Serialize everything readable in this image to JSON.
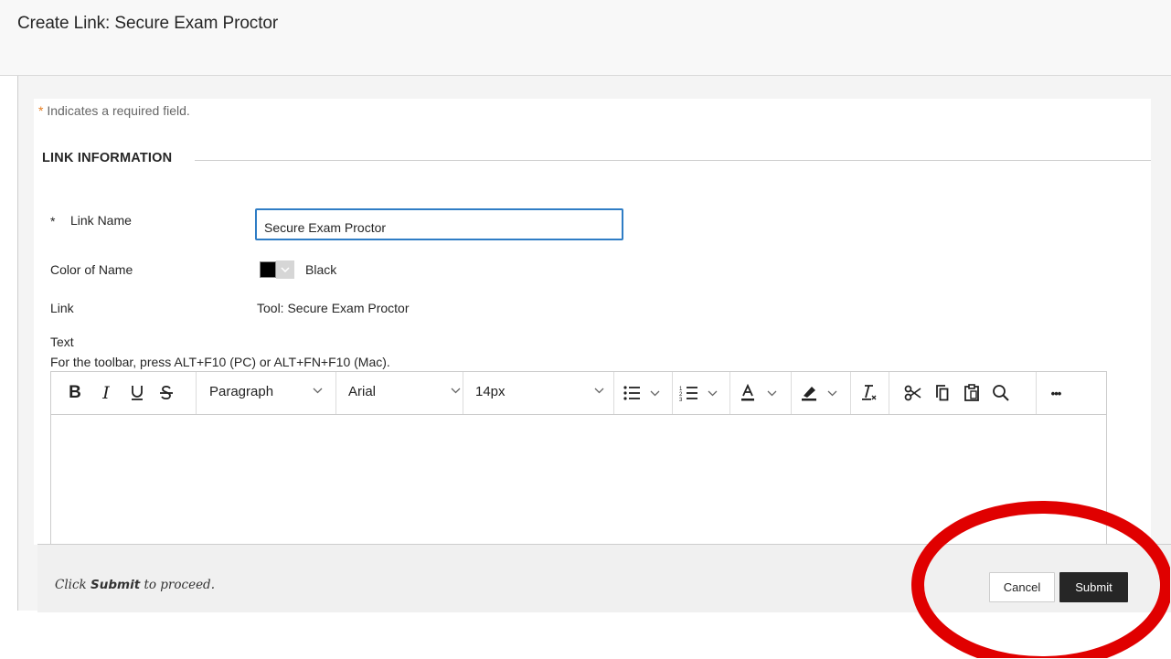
{
  "header": {
    "title": "Create Link: Secure Exam Proctor"
  },
  "form": {
    "required_star": "*",
    "required_text": " Indicates a required field.",
    "section_title": "LINK INFORMATION",
    "link_name": {
      "label": "Link Name",
      "value": "Secure Exam Proctor"
    },
    "color_of_name": {
      "label": "Color of Name",
      "value": "Black",
      "swatch_color": "#000000"
    },
    "link": {
      "label": "Link",
      "value": "Tool: Secure Exam Proctor"
    },
    "text": {
      "label": "Text",
      "help": "For the toolbar, press ALT+F10 (PC) or ALT+FN+F10 (Mac)."
    }
  },
  "editor": {
    "toolbar": {
      "bold": "B",
      "italic": "I",
      "underline": "U",
      "strike": "S",
      "format_select": "Paragraph",
      "font_select": "Arial",
      "size_select": "14px",
      "more": "•••"
    },
    "icons": [
      "bold-icon",
      "italic-icon",
      "underline-icon",
      "strikethrough-icon",
      "bullet-list-icon",
      "numbered-list-icon",
      "text-color-icon",
      "highlight-icon",
      "clear-format-icon",
      "cut-icon",
      "copy-icon",
      "paste-icon",
      "search-icon",
      "more-icon"
    ]
  },
  "footer": {
    "hint_prefix": "Click ",
    "hint_bold": "Submit",
    "hint_suffix": " to proceed.",
    "cancel_label": "Cancel",
    "submit_label": "Submit"
  },
  "colors": {
    "accent_border": "#2f7dc5",
    "required_star": "#e67e22",
    "annotation": "#e00000",
    "submit_bg": "#262626"
  }
}
